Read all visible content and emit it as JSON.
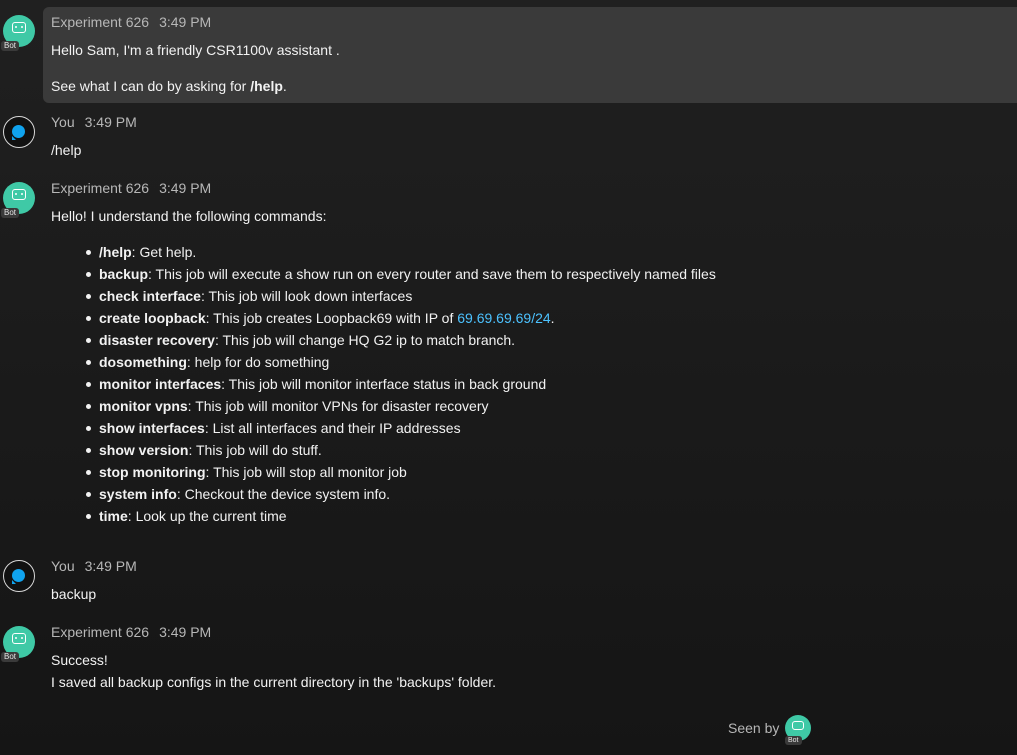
{
  "messages": [
    {
      "sender": "Experiment 626",
      "time": "3:49 PM",
      "badge": "Bot",
      "lines": [
        "Hello Sam, I'm a friendly CSR1100v assistant .",
        "See what I can do by asking for "
      ],
      "bold_cmd": "/help",
      "trail": "."
    },
    {
      "sender": "You",
      "time": "3:49 PM",
      "text": "/help"
    },
    {
      "sender": "Experiment 626",
      "time": "3:49 PM",
      "badge": "Bot",
      "intro": "Hello!  I understand the following commands:",
      "commands": [
        {
          "name": "/help",
          "desc": ": Get help."
        },
        {
          "name": "backup",
          "desc": ": This job will execute a show run on every router and save them to respectively named files"
        },
        {
          "name": "check interface",
          "desc": ": This job will look down interfaces"
        },
        {
          "name": "create loopback",
          "desc": ": This job creates Loopback69 with IP of ",
          "link": "69.69.69.69/24",
          "after": "."
        },
        {
          "name": "disaster recovery",
          "desc": ": This job will change HQ G2 ip to match branch."
        },
        {
          "name": "dosomething",
          "desc": ": help for do something"
        },
        {
          "name": "monitor interfaces",
          "desc": ": This job will monitor interface status in back ground"
        },
        {
          "name": "monitor vpns",
          "desc": ": This job will monitor VPNs for disaster recovery"
        },
        {
          "name": "show interfaces",
          "desc": ": List all interfaces and their IP addresses"
        },
        {
          "name": "show version",
          "desc": ": This job will do stuff."
        },
        {
          "name": "stop monitoring",
          "desc": ": This job will stop all monitor job"
        },
        {
          "name": "system info",
          "desc": ": Checkout the device system info."
        },
        {
          "name": "time",
          "desc": ": Look up the current time"
        }
      ]
    },
    {
      "sender": "You",
      "time": "3:49 PM",
      "text": "backup"
    },
    {
      "sender": "Experiment 626",
      "time": "3:49 PM",
      "badge": "Bot",
      "lines": [
        "Success!",
        "I saved all backup configs in the current directory in the 'backups' folder."
      ]
    }
  ],
  "seen": {
    "label": "Seen by",
    "badge": "Bot"
  },
  "colors": {
    "bot_avatar": "#3fc9a6",
    "you_bubble": "#10a3ee",
    "link": "#4cc2ff",
    "highlight": "#3a3a3a"
  }
}
